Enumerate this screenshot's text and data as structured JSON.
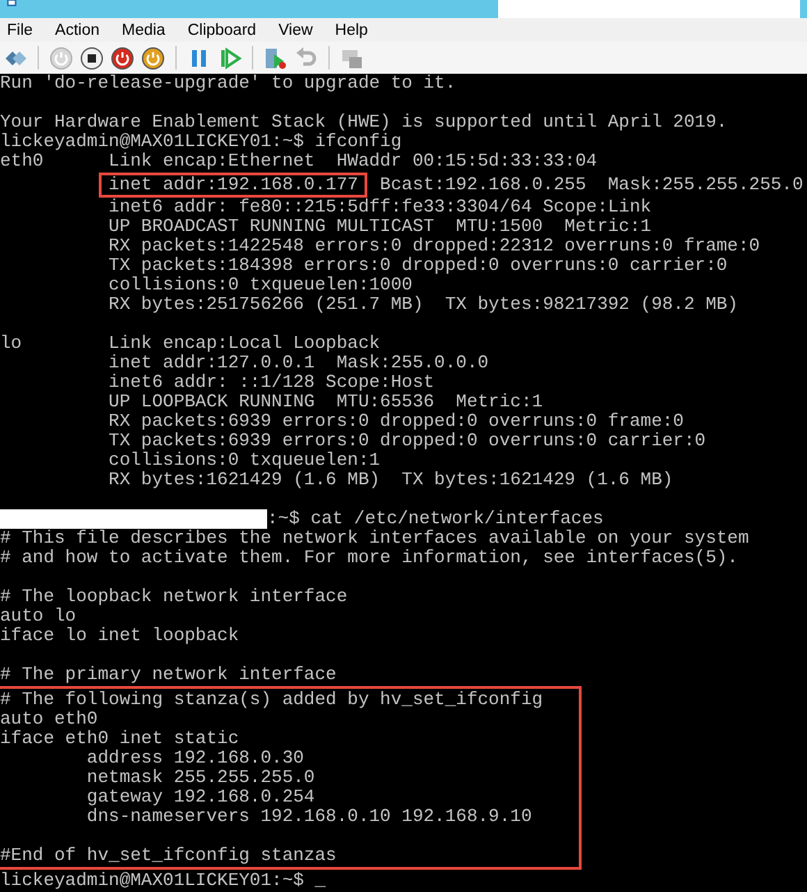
{
  "window": {
    "menu": [
      "File",
      "Action",
      "Media",
      "Clipboard",
      "View",
      "Help"
    ],
    "toolbar": [
      {
        "kind": "ctrl-alt-del",
        "disabled": false
      },
      {
        "kind": "separator"
      },
      {
        "kind": "start",
        "disabled": true
      },
      {
        "kind": "turn-off",
        "disabled": false
      },
      {
        "kind": "shut-down",
        "disabled": false
      },
      {
        "kind": "save",
        "disabled": false
      },
      {
        "kind": "separator"
      },
      {
        "kind": "pause",
        "disabled": false
      },
      {
        "kind": "reset",
        "disabled": false
      },
      {
        "kind": "separator"
      },
      {
        "kind": "checkpoint",
        "disabled": false
      },
      {
        "kind": "revert",
        "disabled": true
      },
      {
        "kind": "separator"
      },
      {
        "kind": "enhanced-session",
        "disabled": true
      }
    ]
  },
  "terminal": {
    "segments": [
      {
        "kind": "line",
        "text": "Run 'do-release-upgrade' to upgrade to it."
      },
      {
        "kind": "blank"
      },
      {
        "kind": "line",
        "text": "Your Hardware Enablement Stack (HWE) is supported until April 2019."
      },
      {
        "kind": "line",
        "text": "lickeyadmin@MAX01LICKEY01:~$ ifconfig"
      },
      {
        "kind": "line",
        "text": "eth0      Link encap:Ethernet  HWaddr 00:15:5d:33:33:04"
      },
      {
        "kind": "annotated_line",
        "annotated": "inet addr:192.168.0.177",
        "text": "  Bcast:192.168.0.255  Mask:255.255.255.0"
      },
      {
        "kind": "line",
        "text": "          inet6 addr: fe80::215:5dff:fe33:3304/64 Scope:Link"
      },
      {
        "kind": "line",
        "text": "          UP BROADCAST RUNNING MULTICAST  MTU:1500  Metric:1"
      },
      {
        "kind": "line",
        "text": "          RX packets:1422548 errors:0 dropped:22312 overruns:0 frame:0"
      },
      {
        "kind": "line",
        "text": "          TX packets:184398 errors:0 dropped:0 overruns:0 carrier:0"
      },
      {
        "kind": "line",
        "text": "          collisions:0 txqueuelen:1000"
      },
      {
        "kind": "line",
        "text": "          RX bytes:251756266 (251.7 MB)  TX bytes:98217392 (98.2 MB)"
      },
      {
        "kind": "blank"
      },
      {
        "kind": "line",
        "text": "lo        Link encap:Local Loopback"
      },
      {
        "kind": "line",
        "text": "          inet addr:127.0.0.1  Mask:255.0.0.0"
      },
      {
        "kind": "line",
        "text": "          inet6 addr: ::1/128 Scope:Host"
      },
      {
        "kind": "line",
        "text": "          UP LOOPBACK RUNNING  MTU:65536  Metric:1"
      },
      {
        "kind": "line",
        "text": "          RX packets:6939 errors:0 dropped:0 overruns:0 frame:0"
      },
      {
        "kind": "line",
        "text": "          TX packets:6939 errors:0 dropped:0 overruns:0 carrier:0"
      },
      {
        "kind": "line",
        "text": "          collisions:0 txqueuelen:1"
      },
      {
        "kind": "line",
        "text": "          RX bytes:1621429 (1.6 MB)  TX bytes:1621429 (1.6 MB)"
      },
      {
        "kind": "blank"
      },
      {
        "kind": "redacted_line",
        "text": ":~$ cat /etc/network/interfaces"
      },
      {
        "kind": "line",
        "text": "# This file describes the network interfaces available on your system"
      },
      {
        "kind": "line",
        "text": "# and how to activate them. For more information, see interfaces(5)."
      },
      {
        "kind": "blank"
      },
      {
        "kind": "line",
        "text": "# The loopback network interface"
      },
      {
        "kind": "line",
        "text": "auto lo"
      },
      {
        "kind": "line",
        "text": "iface lo inet loopback"
      },
      {
        "kind": "blank"
      },
      {
        "kind": "line",
        "text": "# The primary network interface"
      },
      {
        "kind": "annotated_block",
        "lines": [
          {
            "kind": "line",
            "text": "# The following stanza(s) added by hv_set_ifconfig"
          },
          {
            "kind": "line",
            "text": "auto eth0"
          },
          {
            "kind": "line",
            "text": "iface eth0 inet static"
          },
          {
            "kind": "line",
            "text": "        address 192.168.0.30"
          },
          {
            "kind": "line",
            "text": "        netmask 255.255.255.0"
          },
          {
            "kind": "line",
            "text": "        gateway 192.168.0.254"
          },
          {
            "kind": "line",
            "text": "        dns-nameservers 192.168.0.10 192.168.9.10"
          },
          {
            "kind": "blank"
          },
          {
            "kind": "line",
            "text": "#End of hv_set_ifconfig stanzas"
          }
        ]
      },
      {
        "kind": "line",
        "text": "lickeyadmin@MAX01LICKEY01:~$ _"
      }
    ]
  }
}
